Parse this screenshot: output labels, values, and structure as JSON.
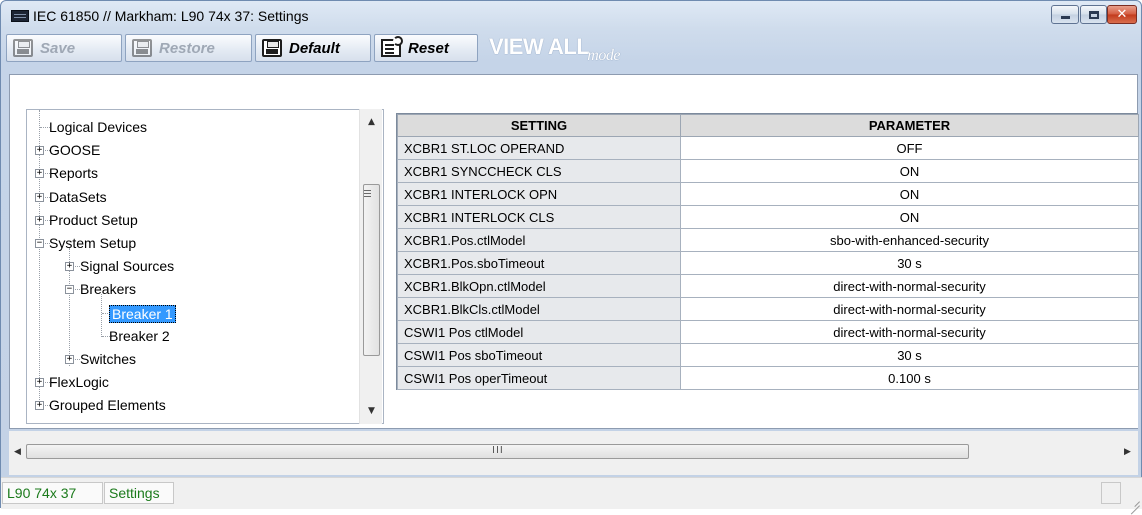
{
  "window": {
    "title": "IEC 61850 // Markham: L90 74x 37: Settings",
    "controls": {
      "minimize_icon": "minimize-icon",
      "maximize_icon": "maximize-icon",
      "close_icon": "close-icon"
    }
  },
  "toolbar": {
    "save_label": "Save",
    "restore_label": "Restore",
    "default_label": "Default",
    "reset_label": "Reset",
    "view_all_label": "VIEW ALL",
    "mode_label": "mode"
  },
  "tree": {
    "items": [
      {
        "label": "Logical Devices",
        "level": 0,
        "expander": "none"
      },
      {
        "label": "GOOSE",
        "level": 0,
        "expander": "plus"
      },
      {
        "label": "Reports",
        "level": 0,
        "expander": "plus"
      },
      {
        "label": "DataSets",
        "level": 0,
        "expander": "plus"
      },
      {
        "label": "Product Setup",
        "level": 0,
        "expander": "plus"
      },
      {
        "label": "System Setup",
        "level": 0,
        "expander": "minus"
      },
      {
        "label": "Signal Sources",
        "level": 1,
        "expander": "plus"
      },
      {
        "label": "Breakers",
        "level": 1,
        "expander": "minus"
      },
      {
        "label": "Breaker 1",
        "level": 2,
        "expander": "none",
        "selected": true
      },
      {
        "label": "Breaker 2",
        "level": 2,
        "expander": "none"
      },
      {
        "label": "Switches",
        "level": 1,
        "expander": "plus"
      },
      {
        "label": "FlexLogic",
        "level": 0,
        "expander": "plus"
      },
      {
        "label": "Grouped Elements",
        "level": 0,
        "expander": "plus"
      }
    ]
  },
  "table": {
    "headers": {
      "setting": "SETTING",
      "parameter": "PARAMETER"
    },
    "rows": [
      {
        "setting": "XCBR1 ST.LOC OPERAND",
        "parameter": "OFF"
      },
      {
        "setting": "XCBR1 SYNCCHECK CLS",
        "parameter": "ON"
      },
      {
        "setting": "XCBR1 INTERLOCK OPN",
        "parameter": "ON"
      },
      {
        "setting": "XCBR1 INTERLOCK CLS",
        "parameter": "ON"
      },
      {
        "setting": "XCBR1.Pos.ctlModel",
        "parameter": "sbo-with-enhanced-security"
      },
      {
        "setting": "XCBR1.Pos.sboTimeout",
        "parameter": "30 s"
      },
      {
        "setting": "XCBR1.BlkOpn.ctlModel",
        "parameter": "direct-with-normal-security"
      },
      {
        "setting": "XCBR1.BlkCls.ctlModel",
        "parameter": "direct-with-normal-security"
      },
      {
        "setting": "CSWI1 Pos ctlModel",
        "parameter": "direct-with-normal-security"
      },
      {
        "setting": "CSWI1 Pos sboTimeout",
        "parameter": "30 s"
      },
      {
        "setting": "CSWI1 Pos operTimeout",
        "parameter": "0.100 s"
      }
    ]
  },
  "hscroll": {
    "grip_label": "III"
  },
  "status": {
    "device": "L90 74x 37",
    "view": "Settings"
  },
  "colors": {
    "selection": "#3399ff",
    "status_text": "#1b7a1b",
    "view_all_text": "#ffffff"
  }
}
